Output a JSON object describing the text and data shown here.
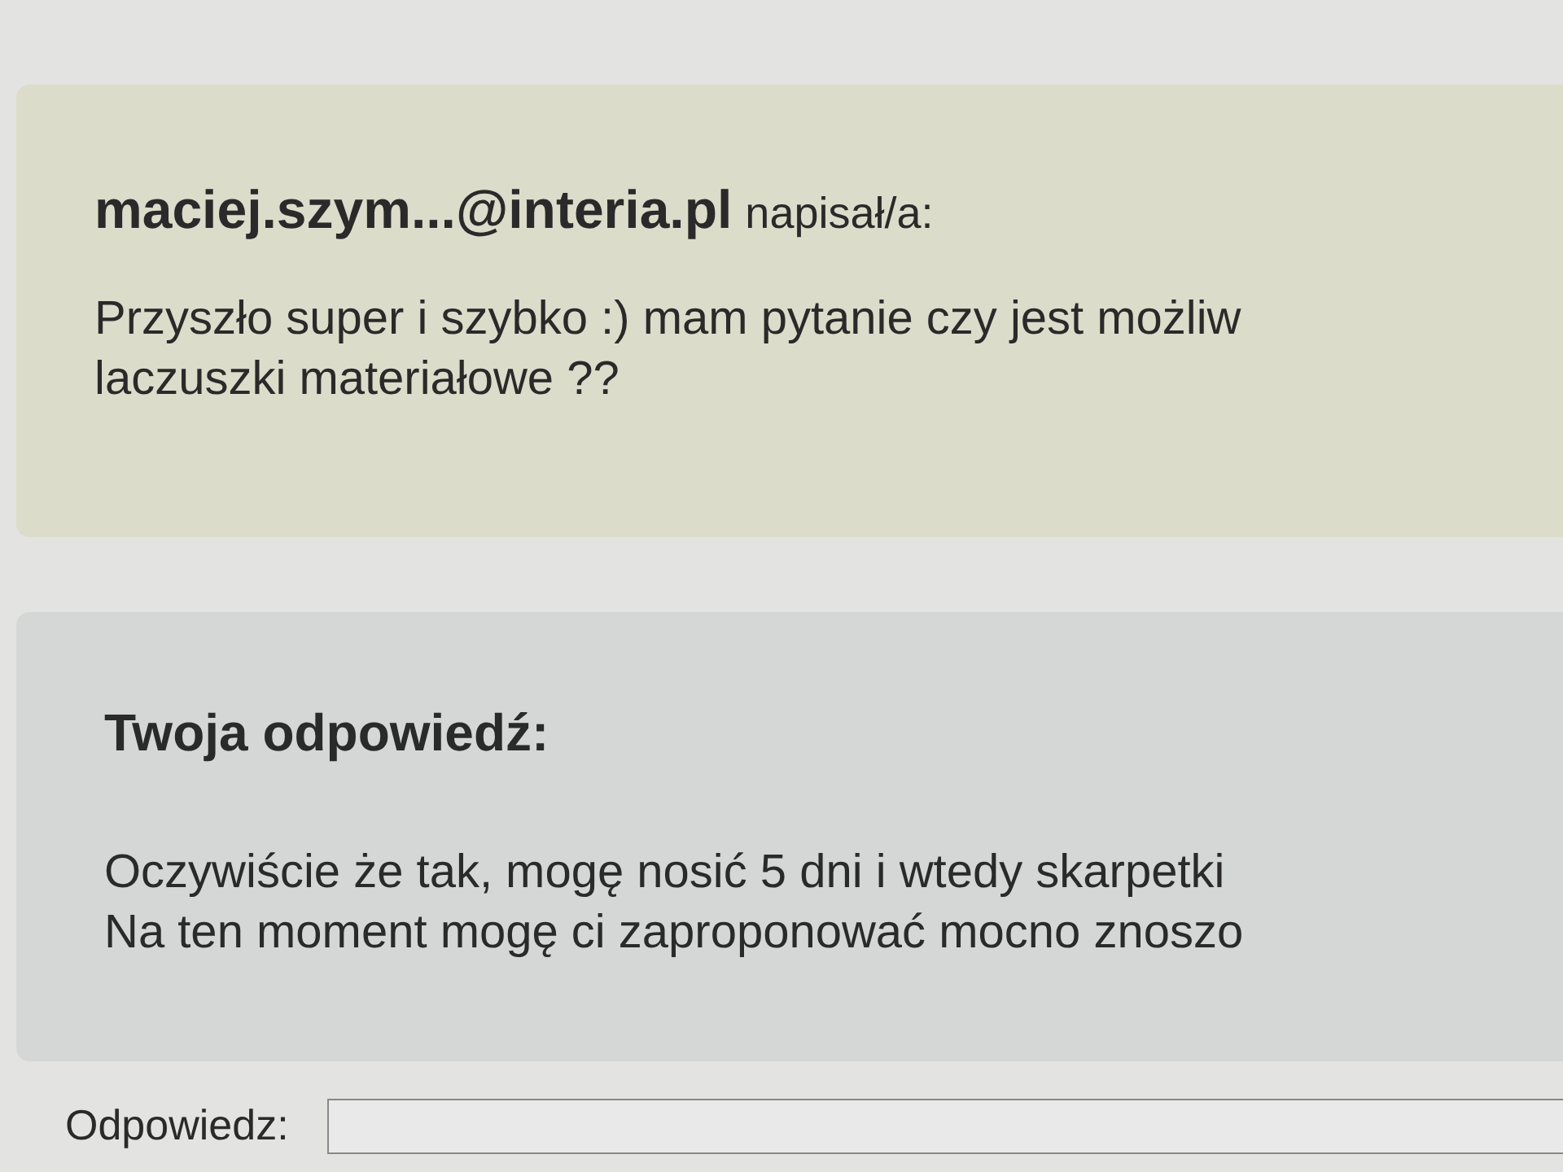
{
  "quoted_message": {
    "author": "maciej.szym...@interia.pl",
    "verb": "napisał/a:",
    "lines": [
      "Przyszło super i szybko :) mam pytanie czy jest możliw",
      "laczuszki materiałowe ??"
    ]
  },
  "your_reply": {
    "heading": "Twoja odpowiedź:",
    "lines": [
      "Oczywiście że tak, mogę nosić 5 dni i wtedy skarpetki",
      "Na ten moment mogę ci zaproponować mocno znoszo"
    ]
  },
  "reply_form": {
    "label": "Odpowiedz:"
  }
}
